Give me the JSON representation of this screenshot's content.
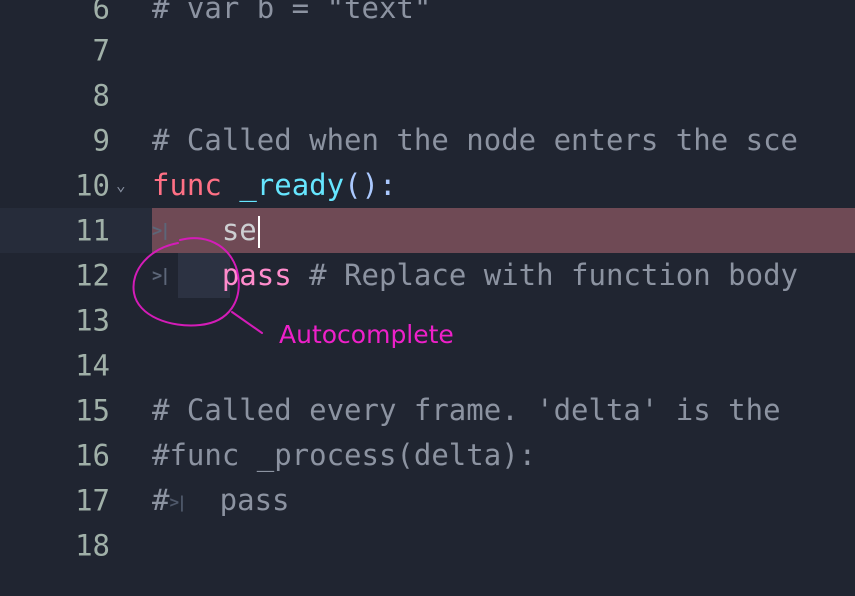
{
  "annotation": {
    "label": "Autocomplete",
    "color": "#ee20c9"
  },
  "lines": [
    {
      "num": "6",
      "text": "# var b = \"text\""
    },
    {
      "num": "7",
      "text": ""
    },
    {
      "num": "8",
      "text": ""
    },
    {
      "num": "9",
      "text": "# Called when the node enters the sce"
    },
    {
      "num": "10",
      "kw": "func",
      "name": "_ready",
      "sym": "():"
    },
    {
      "num": "11",
      "text": "se"
    },
    {
      "num": "12",
      "kw": "pass",
      "text": " # Replace with function body"
    },
    {
      "num": "13",
      "text": ""
    },
    {
      "num": "14",
      "text": ""
    },
    {
      "num": "15",
      "text": "# Called every frame. 'delta' is the"
    },
    {
      "num": "16",
      "text": "#func _process(delta):"
    },
    {
      "num": "17",
      "prefix": "#",
      "text": "pass"
    },
    {
      "num": "18",
      "text": ""
    }
  ],
  "icons": {
    "fold": "chevron-down-icon",
    "tab": "tab-indent-icon"
  }
}
